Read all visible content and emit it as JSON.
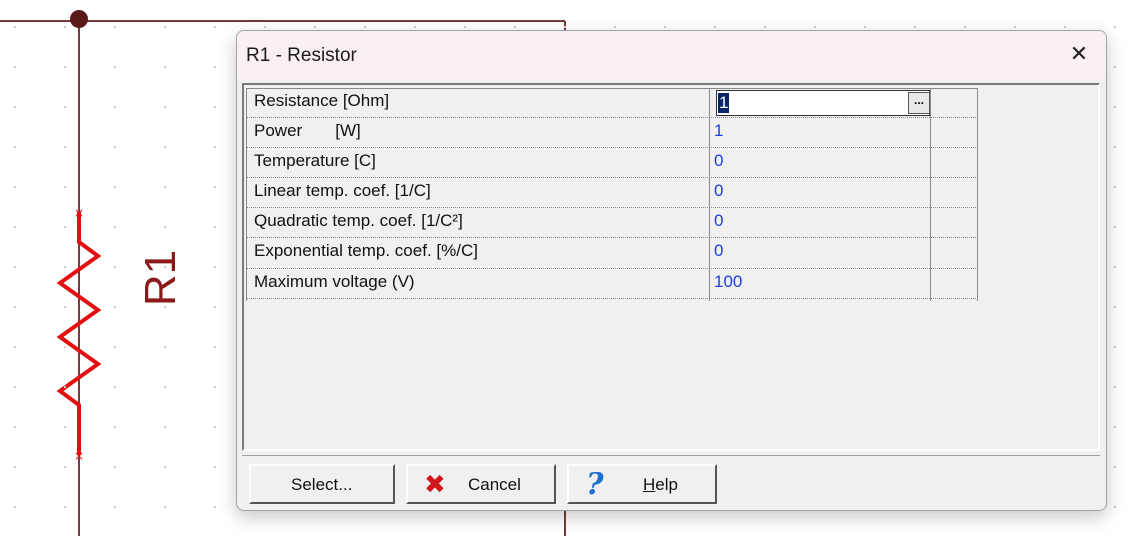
{
  "schematic": {
    "component_label": "R1",
    "wire_color": "#7a3a3a",
    "resistor_color": "#e21010"
  },
  "dialog": {
    "title": "R1 - Resistor",
    "close_glyph": "✕"
  },
  "properties": {
    "rows": [
      {
        "label": "Resistance [Ohm]",
        "value": "1"
      },
      {
        "label": "Power       [W]",
        "value": "1"
      },
      {
        "label": "Temperature [C]",
        "value": "0"
      },
      {
        "label": "Linear temp. coef. [1/C]",
        "value": "0"
      },
      {
        "label": "Quadratic temp. coef. [1/C²]",
        "value": "0"
      },
      {
        "label": "Exponential temp. coef. [%/C]",
        "value": "0"
      },
      {
        "label": "Maximum voltage (V)",
        "value": "100"
      }
    ],
    "edit_value": "1",
    "ellipsis_label": "..."
  },
  "buttons": {
    "select_label": "Select...",
    "cancel_label": "Cancel",
    "help_label_rest": "elp",
    "help_label_hotkey": "H"
  }
}
